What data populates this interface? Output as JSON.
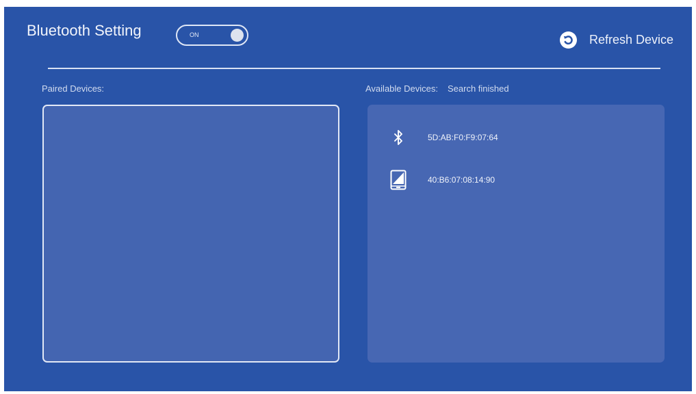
{
  "header": {
    "title": "Bluetooth Setting",
    "toggle_label": "ON",
    "refresh_label": "Refresh Device"
  },
  "paired": {
    "label": "Paired Devices:"
  },
  "available": {
    "label": "Available Devices:",
    "status": "Search finished",
    "devices": [
      {
        "name": "5D:AB:F0:F9:07:64",
        "icon": "bluetooth-icon"
      },
      {
        "name": "40:B6:07:08:14:90",
        "icon": "phone-icon"
      }
    ]
  },
  "colors": {
    "background": "#2954a8",
    "panel": "#4767b3",
    "text": "#ffffff"
  }
}
